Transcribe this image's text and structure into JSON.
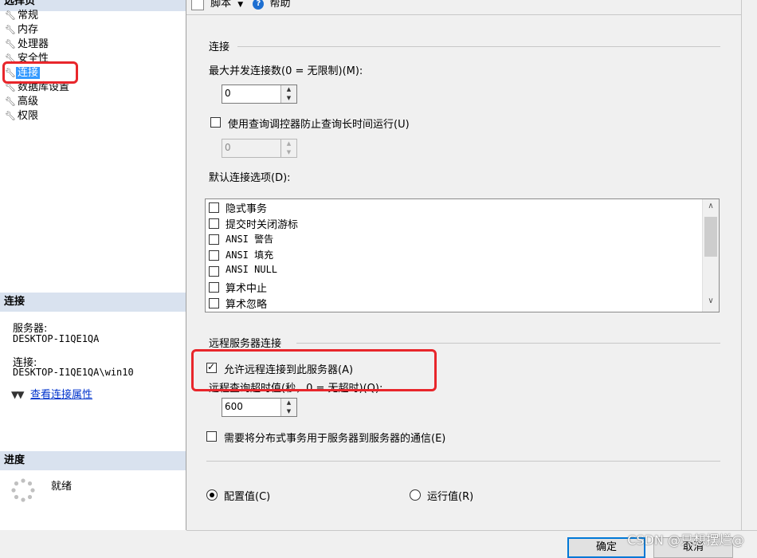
{
  "toolbar": {
    "script_label": "脚本",
    "script_dropdown_glyph": "▼",
    "help_label": "帮助",
    "help_glyph": "?"
  },
  "left": {
    "header": "选择页",
    "pages": [
      "常规",
      "内存",
      "处理器",
      "安全性",
      "连接",
      "数据库设置",
      "高级",
      "权限"
    ],
    "selected_page": "连接",
    "connection": {
      "header": "连接",
      "server_label": "服务器:",
      "server_value": "DESKTOP-I1QE1QA",
      "connection_label": "连接:",
      "connection_value": "DESKTOP-I1QE1QA\\win10",
      "view_properties_link": "查看连接属性"
    },
    "progress": {
      "header": "进度",
      "status": "就绪"
    }
  },
  "connections_group": {
    "title": "连接",
    "max_connections_label": "最大并发连接数(0 = 无限制)(M):",
    "max_connections_value": "0",
    "governor_label": "使用查询调控器防止查询长时间运行(U)",
    "governor_checked": false,
    "governor_value": "0",
    "default_options_label": "默认连接选项(D):",
    "default_options": [
      {
        "label": "隐式事务",
        "checked": false
      },
      {
        "label": "提交时关闭游标",
        "checked": false
      },
      {
        "label": "ANSI 警告",
        "checked": false
      },
      {
        "label": "ANSI 填充",
        "checked": false
      },
      {
        "label": "ANSI NULL",
        "checked": false
      },
      {
        "label": "算术中止",
        "checked": false
      },
      {
        "label": "算术忽略",
        "checked": false
      }
    ]
  },
  "remote_group": {
    "title": "远程服务器连接",
    "allow_remote_label": "允许远程连接到此服务器(A)",
    "allow_remote_checked": true,
    "timeout_label": "远程查询超时值(秒，0 = 无超时)(Q):",
    "timeout_value": "600",
    "distributed_label": "需要将分布式事务用于服务器到服务器的通信(E)",
    "distributed_checked": false
  },
  "value_mode": {
    "configured_label": "配置值(C)",
    "running_label": "运行值(R)",
    "selected": "configured"
  },
  "buttons": {
    "ok_label": "确定",
    "cancel_label": "取消"
  },
  "watermark": "CSDN @只想摆烂@",
  "colors": {
    "selection": "#3399ff",
    "section_header": "#d9e2ef",
    "annotation": "#e8262b",
    "link": "#0033cc"
  }
}
